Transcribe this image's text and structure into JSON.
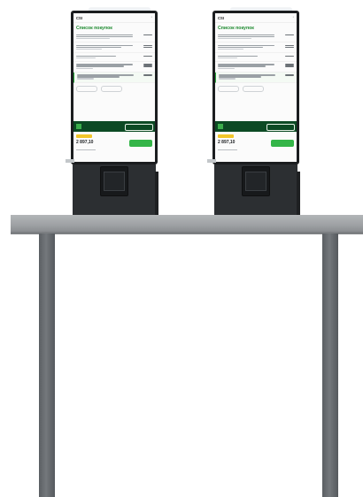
{
  "scene": {
    "kiosk_count": 2,
    "colors": {
      "accent_green": "#2aa83c",
      "banner_green": "#0c4a24",
      "badge_yellow": "#f2c62a",
      "kiosk_body": "#2c2f32",
      "table_metal": "#a3a6a9"
    }
  },
  "kiosks": [
    {
      "logo": "CSI",
      "title": "Список покупок",
      "total": "2 897,10"
    },
    {
      "logo": "CSI",
      "title": "Список покупок",
      "total": "2 897,10"
    }
  ]
}
